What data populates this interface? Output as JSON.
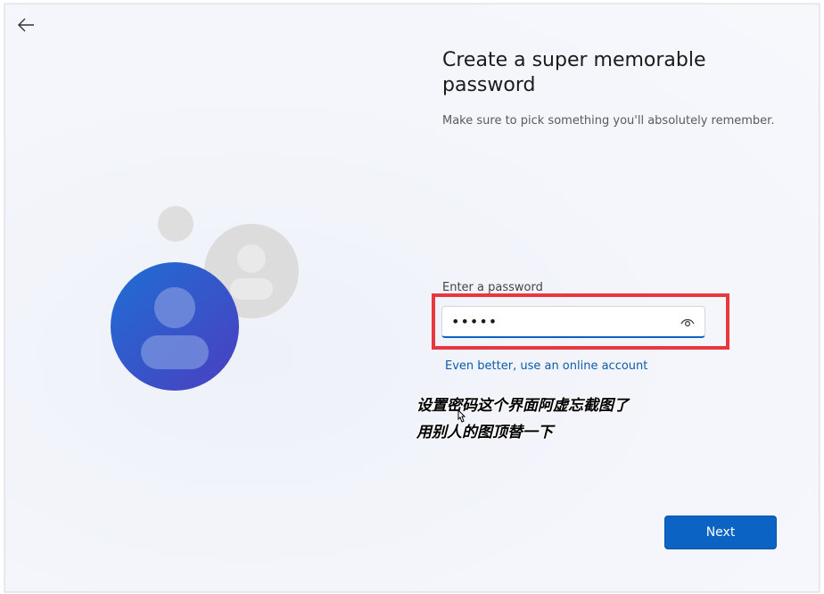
{
  "nav": {
    "back_icon": "arrow-left-icon"
  },
  "header": {
    "title": "Create a super memorable password",
    "subtitle": "Make sure to pick something you'll absolutely remember."
  },
  "form": {
    "password_label": "Enter a password",
    "password_value": "•••••",
    "reveal_icon": "eye-icon",
    "online_account_link": "Even better, use an online account"
  },
  "annotation": {
    "line1": "设置密码这个界面阿虚忘截图了",
    "line2": "用别人的图顶替一下",
    "highlight_color": "#e8383d"
  },
  "actions": {
    "next_label": "Next"
  },
  "colors": {
    "accent": "#0b63c4",
    "avatar_blue": "#2a63c9",
    "avatar_grey": "#dadada"
  }
}
